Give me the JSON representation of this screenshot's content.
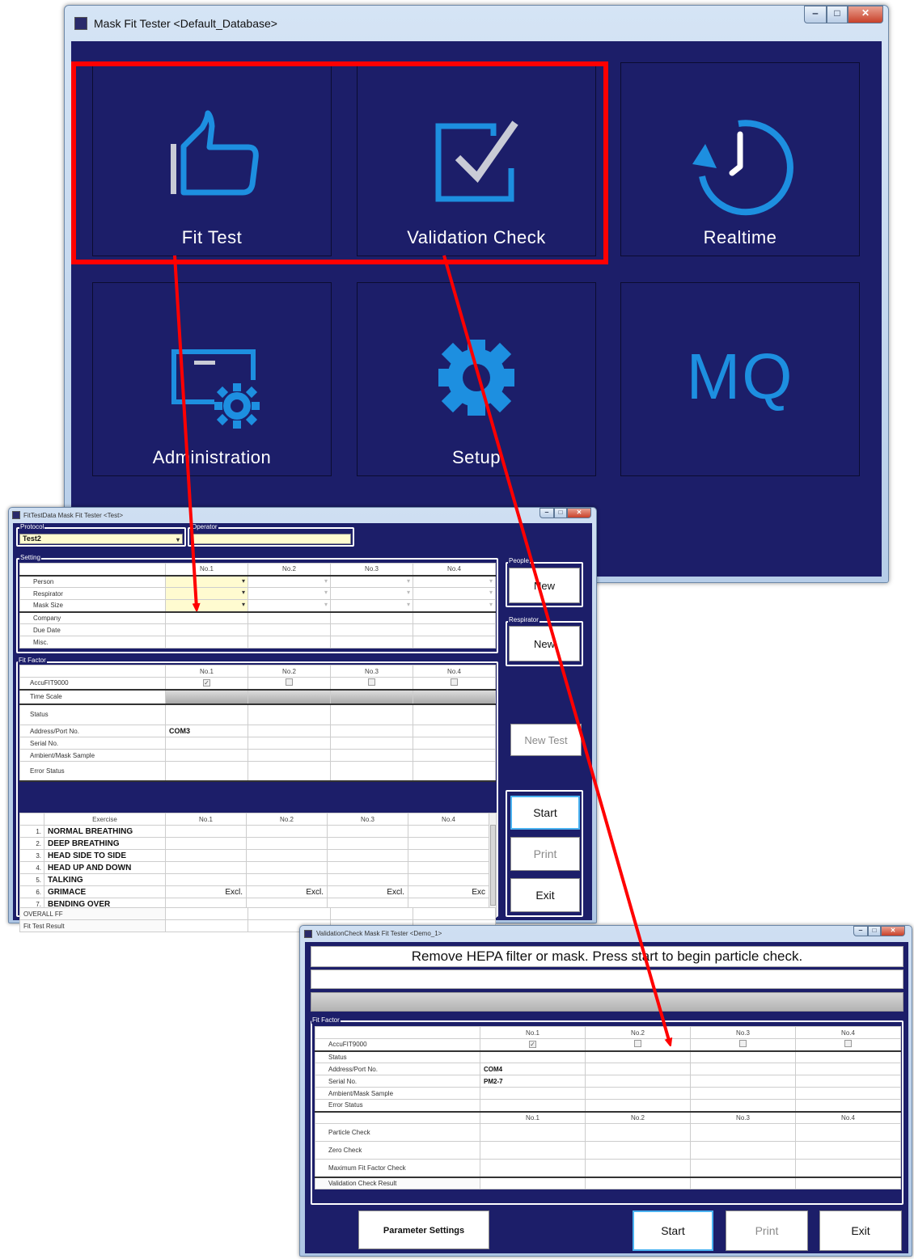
{
  "main_window": {
    "title": "Mask Fit Tester <Default_Database>",
    "tiles": [
      {
        "label": "Fit Test",
        "icon": "thumbs-up-icon"
      },
      {
        "label": "Validation Check",
        "icon": "checkbox-icon"
      },
      {
        "label": "Realtime",
        "icon": "clock-icon"
      },
      {
        "label": "Administration",
        "icon": "certificate-gear-icon"
      },
      {
        "label": "Setup",
        "icon": "gear-icon"
      },
      {
        "label": "",
        "icon": "mq-logo",
        "logo_text": "MQ"
      }
    ]
  },
  "fit_test_window": {
    "title": "FitTestData Mask Fit Tester <Test>",
    "protocol_group": "Protocol",
    "protocol_value": "Test2",
    "operator_group": "Operator",
    "operator_value": "",
    "setting_group": "Setting",
    "columns": [
      "No.1",
      "No.2",
      "No.3",
      "No.4"
    ],
    "setting_rows": [
      "Person",
      "Respirator",
      "Mask Size",
      "Company",
      "Due Date",
      "Misc."
    ],
    "people_group": "People",
    "people_new_label": "New",
    "respirator_group": "Respirator",
    "respirator_new_label": "New",
    "fit_factor_group": "Fit Factor",
    "ff_rows": [
      "AccuFIT9000",
      "Time Scale",
      "Status",
      "Address/Port No.",
      "Serial No.",
      "Ambient/Mask Sample",
      "Error Status"
    ],
    "port_value": "COM3",
    "accufit_checked": [
      true,
      false,
      false,
      false
    ],
    "exercise_header": "Exercise",
    "exercises": [
      {
        "num": "1.",
        "name": "NORMAL BREATHING",
        "values": [
          "",
          "",
          "",
          ""
        ]
      },
      {
        "num": "2.",
        "name": "DEEP BREATHING",
        "values": [
          "",
          "",
          "",
          ""
        ]
      },
      {
        "num": "3.",
        "name": "HEAD SIDE TO SIDE",
        "values": [
          "",
          "",
          "",
          ""
        ]
      },
      {
        "num": "4.",
        "name": "HEAD UP AND DOWN",
        "values": [
          "",
          "",
          "",
          ""
        ]
      },
      {
        "num": "5.",
        "name": "TALKING",
        "values": [
          "",
          "",
          "",
          ""
        ]
      },
      {
        "num": "6.",
        "name": "GRIMACE",
        "values": [
          "Excl.",
          "Excl.",
          "Excl.",
          "Exc"
        ]
      },
      {
        "num": "7.",
        "name": "BENDING OVER",
        "values": [
          "",
          "",
          "",
          ""
        ]
      }
    ],
    "overall_ff_label": "OVERALL FF",
    "fit_test_result_label": "Fit Test Result",
    "new_test_label": "New Test",
    "start_label": "Start",
    "print_label": "Print",
    "exit_label": "Exit"
  },
  "validation_window": {
    "title": "ValidationCheck Mask Fit Tester <Demo_1>",
    "instruction": "Remove HEPA filter or mask. Press start to begin particle check.",
    "fit_factor_group": "Fit Factor",
    "columns": [
      "No.1",
      "No.2",
      "No.3",
      "No.4"
    ],
    "accufit_label": "AccuFIT9000",
    "accufit_checked": [
      true,
      false,
      false,
      false
    ],
    "info_rows": [
      "Status",
      "Address/Port No.",
      "Serial No.",
      "Ambient/Mask Sample",
      "Error Status"
    ],
    "port_value": "COM4",
    "serial_value": "PM2-7",
    "check_rows": [
      "Particle Check",
      "Zero Check",
      "Maximum Fit Factor Check"
    ],
    "result_label": "Validation Check Result",
    "parameter_settings_label": "Parameter Settings",
    "start_label": "Start",
    "print_label": "Print",
    "exit_label": "Exit"
  },
  "colors": {
    "background": "#1c1e69",
    "accent_icon": "#1d8fe0",
    "highlight_box": "#ff0000",
    "arrow": "#ff0000"
  }
}
